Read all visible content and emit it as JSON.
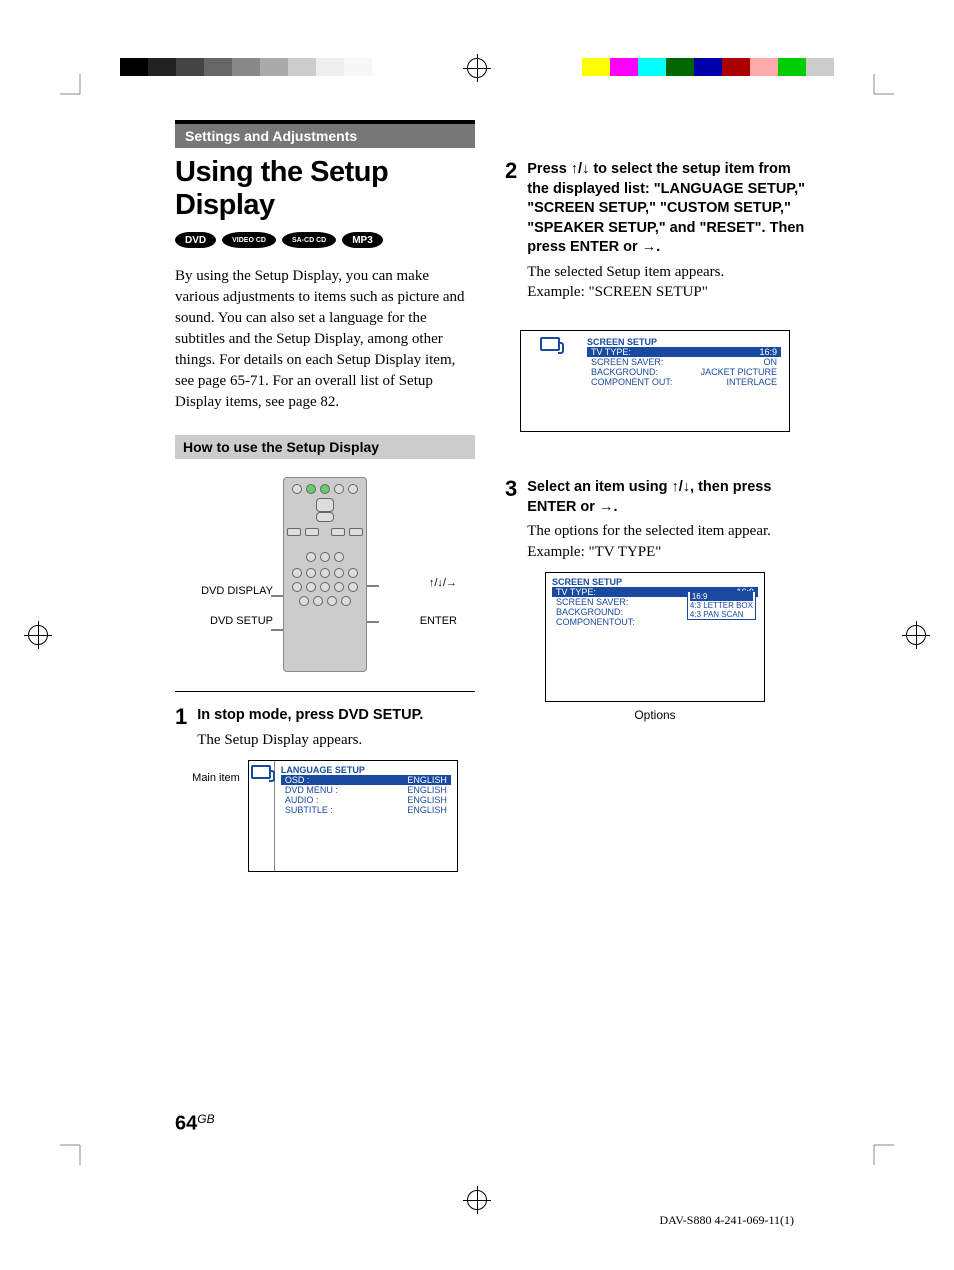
{
  "header": {
    "section": "Settings and Adjustments"
  },
  "title": "Using the Setup Display",
  "badges": [
    "DVD",
    "VIDEO CD",
    "SA-CD CD",
    "MP3"
  ],
  "intro": "By using the Setup Display, you can make various adjustments to items such as picture and sound. You can also set a language for the subtitles and the Setup Display, among other things. For details on each Setup Display item, see page 65-71. For an overall list of Setup Display items, see page 82.",
  "subhead": "How to use the Setup Display",
  "remote_labels": {
    "left1": "DVD DISPLAY",
    "left2": "DVD SETUP",
    "right1": "↑/↓/→",
    "right2": "ENTER"
  },
  "steps": [
    {
      "num": "1",
      "head": "In stop mode, press DVD SETUP.",
      "text": "The Setup Display appears."
    },
    {
      "num": "2",
      "head": "Press ↑/↓ to select the setup item from the displayed list: \"LANGUAGE SETUP,\" \"SCREEN SETUP,\" \"CUSTOM SETUP,\" \"SPEAKER SETUP,\" and \"RESET\". Then press ENTER or →.",
      "text": "The selected Setup item appears.",
      "example": "Example: \"SCREEN SETUP\""
    },
    {
      "num": "3",
      "head": "Select an item using ↑/↓, then press ENTER or →.",
      "text": "The options for the selected item appear.",
      "example": "Example: \"TV TYPE\""
    }
  ],
  "osd1": {
    "side_label": "Main item",
    "title": "LANGUAGE SETUP",
    "rows": [
      {
        "label": "OSD :",
        "value": "ENGLISH",
        "hi": true
      },
      {
        "label": "DVD MENU :",
        "value": "ENGLISH"
      },
      {
        "label": "AUDIO :",
        "value": "ENGLISH"
      },
      {
        "label": "SUBTITLE :",
        "value": "ENGLISH"
      }
    ]
  },
  "osd2": {
    "title": "SCREEN SETUP",
    "rows": [
      {
        "label": "TV TYPE:",
        "value": "16:9",
        "hi": true
      },
      {
        "label": "SCREEN SAVER:",
        "value": "ON"
      },
      {
        "label": "BACKGROUND:",
        "value": "JACKET PICTURE"
      },
      {
        "label": "COMPONENT OUT:",
        "value": "INTERLACE"
      }
    ]
  },
  "osd3": {
    "title": "SCREEN SETUP",
    "rows": [
      {
        "label": "TV TYPE:",
        "value": "16:9",
        "hi": true
      },
      {
        "label": "SCREEN SAVER:",
        "value": ""
      },
      {
        "label": "BACKGROUND:",
        "value": ""
      },
      {
        "label": "COMPONENTOUT:",
        "value": ""
      }
    ],
    "options": [
      "16:9",
      "4:3 LETTER BOX",
      "4:3 PAN SCAN"
    ],
    "options_label": "Options"
  },
  "page_number": "64",
  "page_suffix": "GB",
  "footer": "DAV-S880 4-241-069-11(1)"
}
